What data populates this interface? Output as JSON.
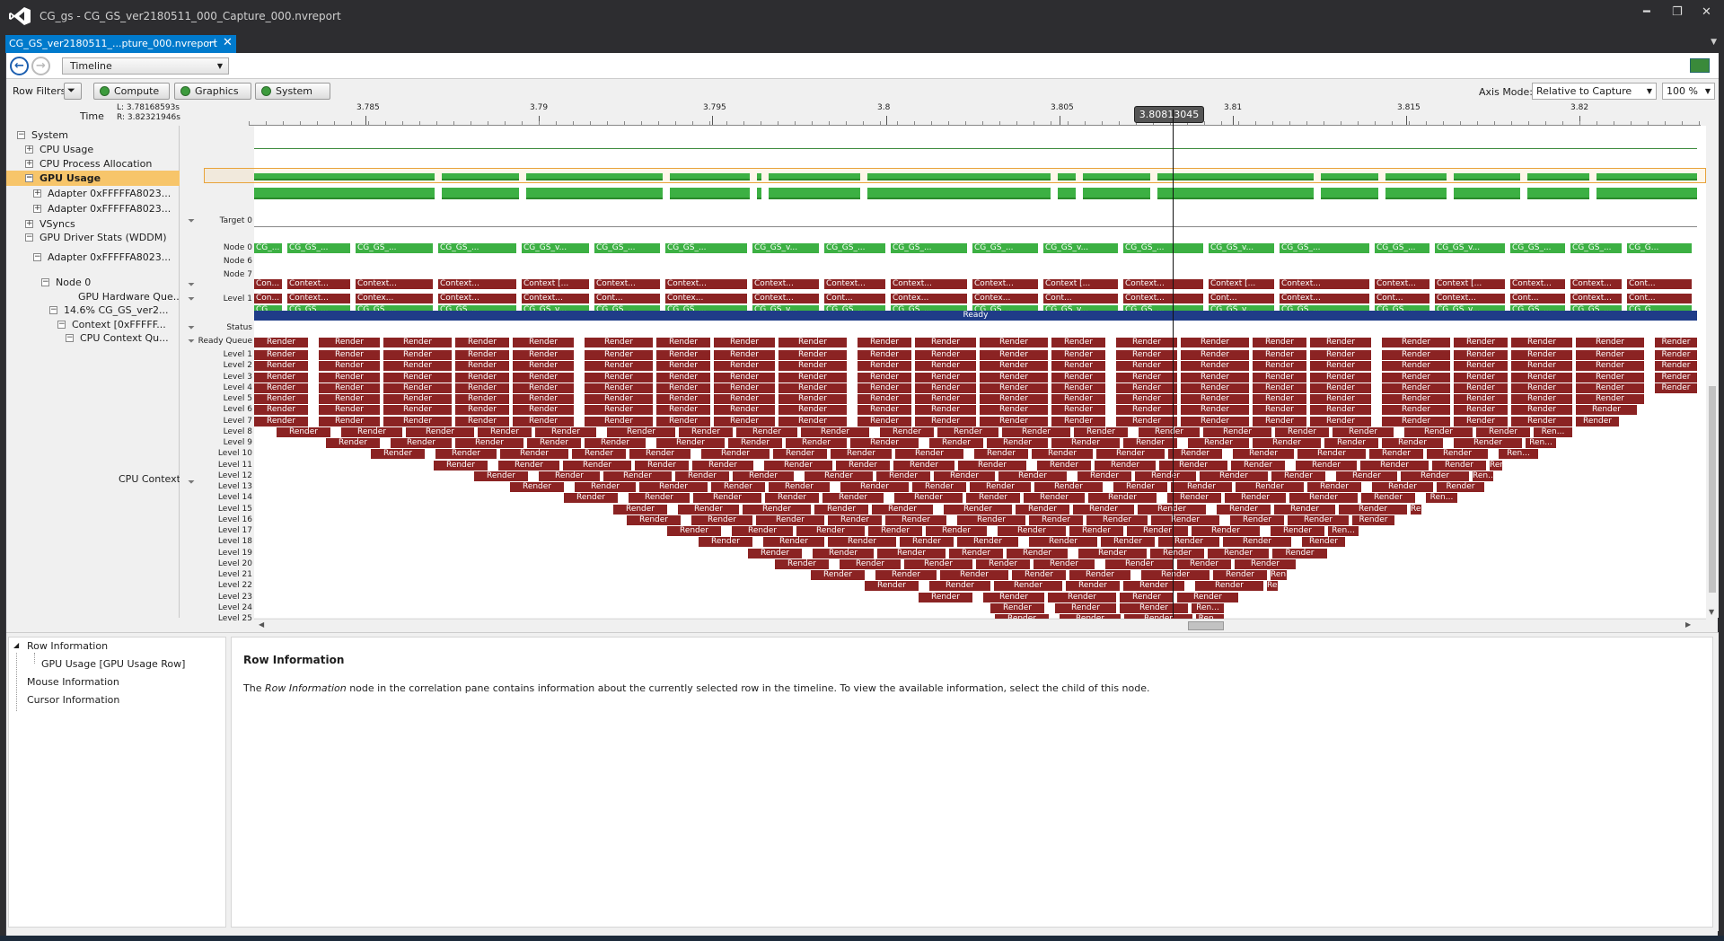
{
  "window": {
    "title": "CG_gs - CG_GS_ver2180511_000_Capture_000.nvreport",
    "minimize": "━",
    "restore": "❐",
    "close": "✕"
  },
  "tab": {
    "label": "CG_GS_ver2180511_...pture_000.nvreport",
    "pin": "⊣",
    "close": "✕"
  },
  "nav": {
    "back": "←",
    "forward": "→",
    "view": "Timeline"
  },
  "filters": {
    "label": "Row Filters",
    "compute": "Compute",
    "graphics": "Graphics",
    "system": "System"
  },
  "axis": {
    "mode_label": "Axis Mode:",
    "mode_value": "Relative to Capture",
    "zoom": "100 %"
  },
  "time": {
    "label": "Time",
    "left": "L: 3.78168593s",
    "right": "R: 3.82321946s",
    "cursor": "3.80813045",
    "ticks": [
      "3.785",
      "3.79",
      "3.795",
      "3.8",
      "3.805",
      "3.81",
      "3.815",
      "3.82"
    ]
  },
  "tree": [
    {
      "label": "System",
      "indent": 0,
      "expander": "−"
    },
    {
      "label": "CPU Usage",
      "indent": 1,
      "expander": "+"
    },
    {
      "label": "CPU Process Allocation",
      "indent": 1,
      "expander": "+"
    },
    {
      "label": "GPU Usage",
      "indent": 1,
      "expander": "−",
      "selected": true
    },
    {
      "label": "Adapter 0xFFFFFA8023...",
      "indent": 2,
      "expander": "+"
    },
    {
      "label": "Adapter 0xFFFFFA8023...",
      "indent": 2,
      "expander": "+"
    },
    {
      "label": "VSyncs",
      "indent": 1,
      "expander": "+"
    },
    {
      "label": "GPU Driver Stats (WDDM)",
      "indent": 1,
      "expander": "−"
    },
    {
      "label": "Adapter 0xFFFFFA8023...",
      "indent": 2,
      "expander": "−"
    },
    {
      "label": "Node 0",
      "indent": 3,
      "expander": "−"
    },
    {
      "label": "GPU Hardware Que...",
      "indent": 4,
      "expander": ""
    },
    {
      "label": "14.6% CG_GS_ver2...",
      "indent": 4,
      "expander": "−"
    },
    {
      "label": "Context [0xFFFFF...",
      "indent": 5,
      "expander": "−"
    },
    {
      "label": "CPU Context Qu...",
      "indent": 6,
      "expander": "−"
    },
    {
      "label": "CPU Context...",
      "indent": 5,
      "expander": ""
    }
  ],
  "row_labels": {
    "target": "Target 0",
    "node0": "Node 0",
    "node6": "Node 6",
    "node7": "Node 7",
    "level1": "Level 1",
    "status": "Status",
    "ready_queue": "Ready Queue"
  },
  "ready_label": "Ready",
  "levels": [
    "Level 1",
    "Level 2",
    "Level 3",
    "Level 4",
    "Level 5",
    "Level 6",
    "Level 7",
    "Level 8",
    "Level 9",
    "Level 10",
    "Level 11",
    "Level 12",
    "Level 13",
    "Level 14",
    "Level 15",
    "Level 16",
    "Level 17",
    "Level 18",
    "Level 19",
    "Level 20",
    "Level 21",
    "Level 22",
    "Level 23",
    "Level 24",
    "Level 25"
  ],
  "node0_labels": [
    "CG_...",
    "CG_GS_...",
    "CG_GS_...",
    "CG_GS_...",
    "CG_GS_v...",
    "CG_GS_...",
    "CG_GS_...",
    "CG_GS_v...",
    "CG_GS_...",
    "CG_GS_...",
    "CG_GS_...",
    "CG_GS_v...",
    "CG_GS_...",
    "CG_GS_v...",
    "CG_GS_...",
    "CG_GS_...",
    "CG_GS_v...",
    "CG_GS_...",
    "CG_GS_...",
    "CG_G..."
  ],
  "node0_ctx_labels": [
    "Con...",
    "Context...",
    "Context...",
    "Context...",
    "Context [...",
    "Context...",
    "Context...",
    "Context...",
    "Context...",
    "Context...",
    "Context...",
    "Context [...",
    "Context...",
    "Context [...",
    "Context...",
    "Context...",
    "Context [...",
    "Context...",
    "Context...",
    "Cont..."
  ],
  "hwq_labels": [
    "Con...",
    "Context...",
    "Contex...",
    "Context...",
    "Context...",
    "Cont...",
    "Contex...",
    "Context...",
    "Cont...",
    "Contex...",
    "Contex...",
    "Cont...",
    "Context...",
    "Cont...",
    "Context...",
    "Cont...",
    "Context...",
    "Cont...",
    "Context...",
    "Cont..."
  ],
  "render_label": "Render",
  "render_short": "Ren...",
  "corr": {
    "root": "Row Information",
    "child": "GPU Usage [GPU Usage Row]",
    "mouse": "Mouse Information",
    "cursor": "Cursor Information"
  },
  "info": {
    "title": "Row Information",
    "text_before": "The ",
    "text_em": "Row Information",
    "text_after": " node in the correlation pane contains information about the currently selected row in the timeline. To view the available information, select the child of this node."
  },
  "colors": {
    "accent": "#007acc",
    "gpu_green": "#3cb043",
    "render_red": "#8b2323",
    "ready_blue": "#1f3c88",
    "selected_row": "#f7c56a"
  }
}
